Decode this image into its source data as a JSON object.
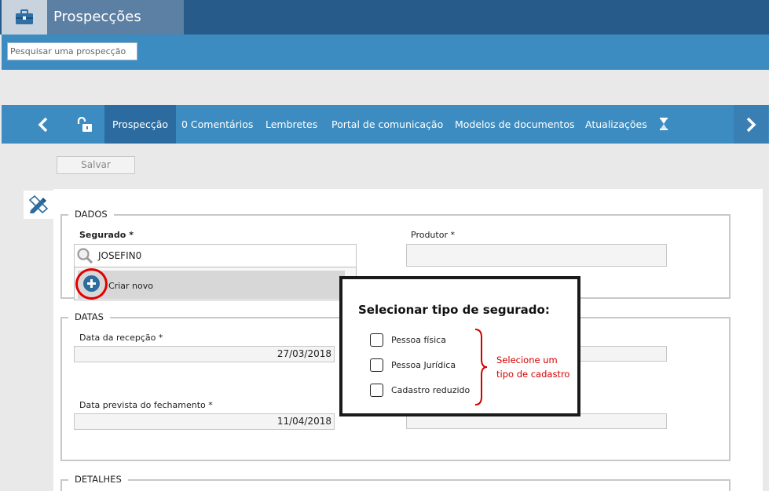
{
  "header": {
    "title": "Prospecções",
    "home_icon": "briefcase-icon"
  },
  "search": {
    "placeholder": "Pesquisar uma prospecção"
  },
  "nav": {
    "tabs": [
      {
        "label": "Prospecção",
        "active": true
      },
      {
        "label": "0 Comentários"
      },
      {
        "label": "Lembretes"
      },
      {
        "label": "Portal de comunicação"
      },
      {
        "label": "Modelos de documentos"
      },
      {
        "label": "Atualizações"
      }
    ]
  },
  "toolbar": {
    "save_label": "Salvar"
  },
  "dados": {
    "legend": "DADOS",
    "segurado_label": "Segurado *",
    "segurado_value": "JOSEFIN0",
    "produtor_label": "Produtor *",
    "create_new_label": "Criar novo"
  },
  "datas": {
    "legend": "DATAS",
    "recepcao_label": "Data da recepção *",
    "recepcao_value": "27/03/2018",
    "fechamento_label": "Data prevista do fechamento *",
    "fechamento_value": "11/04/2018"
  },
  "detalhes": {
    "legend": "DETALHES"
  },
  "modal": {
    "title": "Selecionar tipo de segurado:",
    "options": [
      "Pessoa física",
      "Pessoa Jurídica",
      "Cadastro reduzido"
    ],
    "note_line1": "Selecione um",
    "note_line2": "tipo de cadastro"
  },
  "colors": {
    "header": "#265b8a",
    "accent": "#3d8cc1",
    "highlight": "#e00000"
  }
}
